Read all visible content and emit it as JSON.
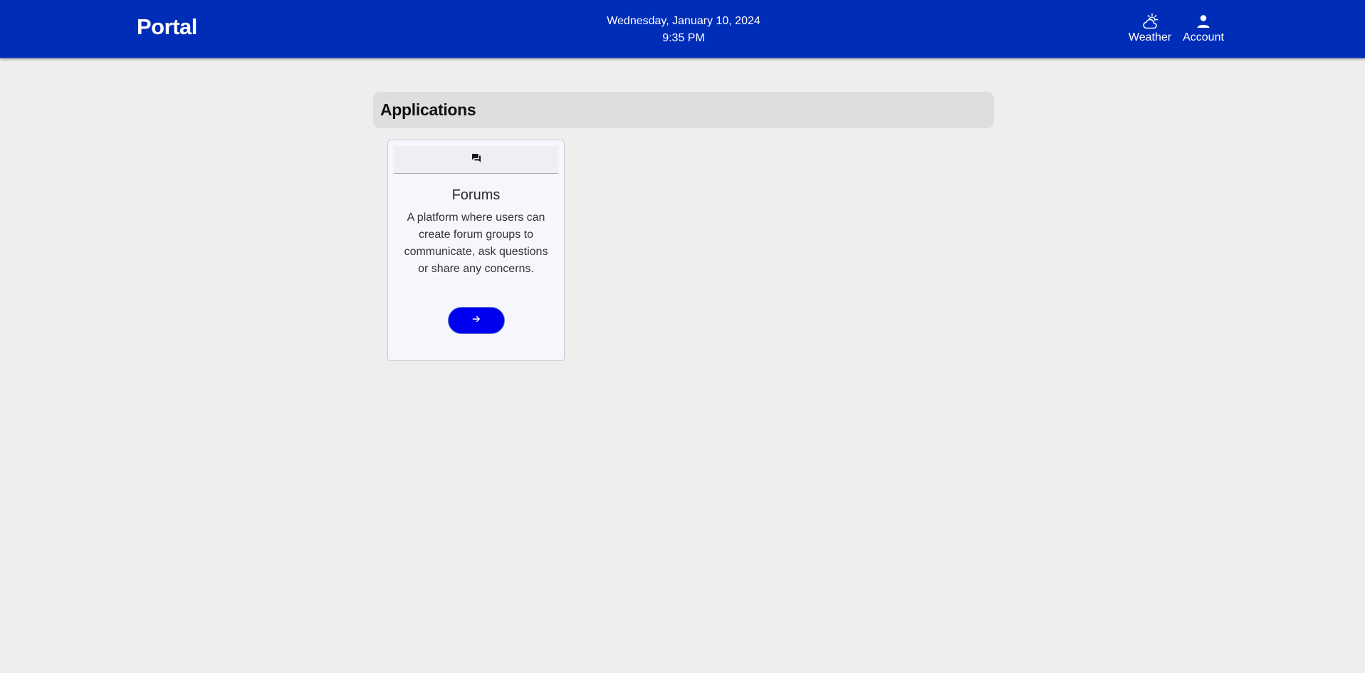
{
  "header": {
    "brand": "Portal",
    "date": "Wednesday, January 10, 2024",
    "time": "9:35 PM",
    "nav": {
      "weather_label": "Weather",
      "weather_icon": "partly-cloudy-icon",
      "account_label": "Account",
      "account_icon": "person-icon"
    },
    "colors": {
      "background": "#002db8",
      "text": "#ffffff"
    }
  },
  "main": {
    "section_title": "Applications",
    "apps": [
      {
        "icon": "forum-icon",
        "title": "Forums",
        "description": "A platform where users can create forum groups to communicate, ask questions or share any concerns.",
        "button_icon": "arrow-right-icon",
        "button_color": "#0000f0"
      }
    ]
  },
  "page": {
    "background": "#eeeeee"
  }
}
